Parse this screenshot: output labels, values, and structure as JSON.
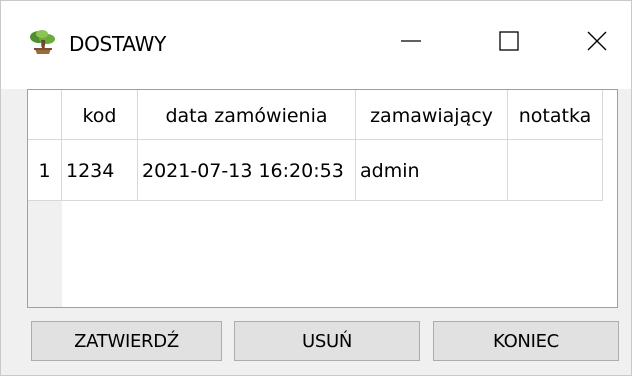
{
  "window": {
    "title": "DOSTAWY",
    "icon": "bonsai-tree-icon",
    "controls": [
      "minimize-icon",
      "maximize-icon",
      "close-icon"
    ]
  },
  "table": {
    "columns": [
      "kod",
      "data zamówienia",
      "zamawiający",
      "notatka"
    ],
    "rows": [
      {
        "row_header": "1",
        "cells": [
          "1234",
          "2021-07-13 16:20:53",
          "admin",
          ""
        ]
      }
    ]
  },
  "buttons": {
    "confirm": "ZATWIERDŹ",
    "delete": "USUŃ",
    "end": "KONIEC"
  }
}
